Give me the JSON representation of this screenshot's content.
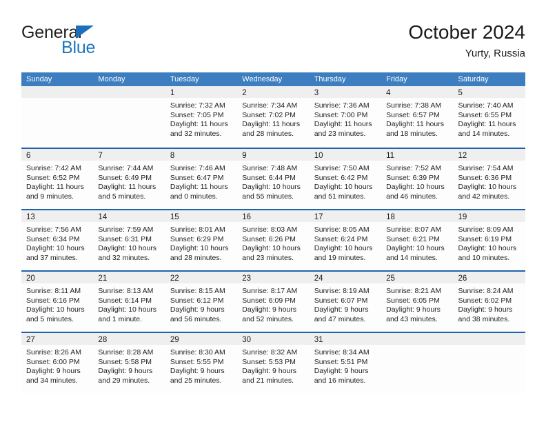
{
  "brand": {
    "name_part1": "General",
    "name_part2": "Blue",
    "triangle_color": "#1c6fba",
    "blue_color": "#1c75bc"
  },
  "header": {
    "title": "October 2024",
    "subtitle": "Yurty, Russia"
  },
  "colors": {
    "header_bar": "#3c7ebf",
    "row_divider": "#1f62ac",
    "day_band": "#efefef",
    "text": "#222222"
  },
  "weekdays": [
    "Sunday",
    "Monday",
    "Tuesday",
    "Wednesday",
    "Thursday",
    "Friday",
    "Saturday"
  ],
  "weeks": [
    [
      {
        "day": "",
        "sunrise": "",
        "sunset": "",
        "daylight1": "",
        "daylight2": ""
      },
      {
        "day": "",
        "sunrise": "",
        "sunset": "",
        "daylight1": "",
        "daylight2": ""
      },
      {
        "day": "1",
        "sunrise": "Sunrise: 7:32 AM",
        "sunset": "Sunset: 7:05 PM",
        "daylight1": "Daylight: 11 hours",
        "daylight2": "and 32 minutes."
      },
      {
        "day": "2",
        "sunrise": "Sunrise: 7:34 AM",
        "sunset": "Sunset: 7:02 PM",
        "daylight1": "Daylight: 11 hours",
        "daylight2": "and 28 minutes."
      },
      {
        "day": "3",
        "sunrise": "Sunrise: 7:36 AM",
        "sunset": "Sunset: 7:00 PM",
        "daylight1": "Daylight: 11 hours",
        "daylight2": "and 23 minutes."
      },
      {
        "day": "4",
        "sunrise": "Sunrise: 7:38 AM",
        "sunset": "Sunset: 6:57 PM",
        "daylight1": "Daylight: 11 hours",
        "daylight2": "and 18 minutes."
      },
      {
        "day": "5",
        "sunrise": "Sunrise: 7:40 AM",
        "sunset": "Sunset: 6:55 PM",
        "daylight1": "Daylight: 11 hours",
        "daylight2": "and 14 minutes."
      }
    ],
    [
      {
        "day": "6",
        "sunrise": "Sunrise: 7:42 AM",
        "sunset": "Sunset: 6:52 PM",
        "daylight1": "Daylight: 11 hours",
        "daylight2": "and 9 minutes."
      },
      {
        "day": "7",
        "sunrise": "Sunrise: 7:44 AM",
        "sunset": "Sunset: 6:49 PM",
        "daylight1": "Daylight: 11 hours",
        "daylight2": "and 5 minutes."
      },
      {
        "day": "8",
        "sunrise": "Sunrise: 7:46 AM",
        "sunset": "Sunset: 6:47 PM",
        "daylight1": "Daylight: 11 hours",
        "daylight2": "and 0 minutes."
      },
      {
        "day": "9",
        "sunrise": "Sunrise: 7:48 AM",
        "sunset": "Sunset: 6:44 PM",
        "daylight1": "Daylight: 10 hours",
        "daylight2": "and 55 minutes."
      },
      {
        "day": "10",
        "sunrise": "Sunrise: 7:50 AM",
        "sunset": "Sunset: 6:42 PM",
        "daylight1": "Daylight: 10 hours",
        "daylight2": "and 51 minutes."
      },
      {
        "day": "11",
        "sunrise": "Sunrise: 7:52 AM",
        "sunset": "Sunset: 6:39 PM",
        "daylight1": "Daylight: 10 hours",
        "daylight2": "and 46 minutes."
      },
      {
        "day": "12",
        "sunrise": "Sunrise: 7:54 AM",
        "sunset": "Sunset: 6:36 PM",
        "daylight1": "Daylight: 10 hours",
        "daylight2": "and 42 minutes."
      }
    ],
    [
      {
        "day": "13",
        "sunrise": "Sunrise: 7:56 AM",
        "sunset": "Sunset: 6:34 PM",
        "daylight1": "Daylight: 10 hours",
        "daylight2": "and 37 minutes."
      },
      {
        "day": "14",
        "sunrise": "Sunrise: 7:59 AM",
        "sunset": "Sunset: 6:31 PM",
        "daylight1": "Daylight: 10 hours",
        "daylight2": "and 32 minutes."
      },
      {
        "day": "15",
        "sunrise": "Sunrise: 8:01 AM",
        "sunset": "Sunset: 6:29 PM",
        "daylight1": "Daylight: 10 hours",
        "daylight2": "and 28 minutes."
      },
      {
        "day": "16",
        "sunrise": "Sunrise: 8:03 AM",
        "sunset": "Sunset: 6:26 PM",
        "daylight1": "Daylight: 10 hours",
        "daylight2": "and 23 minutes."
      },
      {
        "day": "17",
        "sunrise": "Sunrise: 8:05 AM",
        "sunset": "Sunset: 6:24 PM",
        "daylight1": "Daylight: 10 hours",
        "daylight2": "and 19 minutes."
      },
      {
        "day": "18",
        "sunrise": "Sunrise: 8:07 AM",
        "sunset": "Sunset: 6:21 PM",
        "daylight1": "Daylight: 10 hours",
        "daylight2": "and 14 minutes."
      },
      {
        "day": "19",
        "sunrise": "Sunrise: 8:09 AM",
        "sunset": "Sunset: 6:19 PM",
        "daylight1": "Daylight: 10 hours",
        "daylight2": "and 10 minutes."
      }
    ],
    [
      {
        "day": "20",
        "sunrise": "Sunrise: 8:11 AM",
        "sunset": "Sunset: 6:16 PM",
        "daylight1": "Daylight: 10 hours",
        "daylight2": "and 5 minutes."
      },
      {
        "day": "21",
        "sunrise": "Sunrise: 8:13 AM",
        "sunset": "Sunset: 6:14 PM",
        "daylight1": "Daylight: 10 hours",
        "daylight2": "and 1 minute."
      },
      {
        "day": "22",
        "sunrise": "Sunrise: 8:15 AM",
        "sunset": "Sunset: 6:12 PM",
        "daylight1": "Daylight: 9 hours",
        "daylight2": "and 56 minutes."
      },
      {
        "day": "23",
        "sunrise": "Sunrise: 8:17 AM",
        "sunset": "Sunset: 6:09 PM",
        "daylight1": "Daylight: 9 hours",
        "daylight2": "and 52 minutes."
      },
      {
        "day": "24",
        "sunrise": "Sunrise: 8:19 AM",
        "sunset": "Sunset: 6:07 PM",
        "daylight1": "Daylight: 9 hours",
        "daylight2": "and 47 minutes."
      },
      {
        "day": "25",
        "sunrise": "Sunrise: 8:21 AM",
        "sunset": "Sunset: 6:05 PM",
        "daylight1": "Daylight: 9 hours",
        "daylight2": "and 43 minutes."
      },
      {
        "day": "26",
        "sunrise": "Sunrise: 8:24 AM",
        "sunset": "Sunset: 6:02 PM",
        "daylight1": "Daylight: 9 hours",
        "daylight2": "and 38 minutes."
      }
    ],
    [
      {
        "day": "27",
        "sunrise": "Sunrise: 8:26 AM",
        "sunset": "Sunset: 6:00 PM",
        "daylight1": "Daylight: 9 hours",
        "daylight2": "and 34 minutes."
      },
      {
        "day": "28",
        "sunrise": "Sunrise: 8:28 AM",
        "sunset": "Sunset: 5:58 PM",
        "daylight1": "Daylight: 9 hours",
        "daylight2": "and 29 minutes."
      },
      {
        "day": "29",
        "sunrise": "Sunrise: 8:30 AM",
        "sunset": "Sunset: 5:55 PM",
        "daylight1": "Daylight: 9 hours",
        "daylight2": "and 25 minutes."
      },
      {
        "day": "30",
        "sunrise": "Sunrise: 8:32 AM",
        "sunset": "Sunset: 5:53 PM",
        "daylight1": "Daylight: 9 hours",
        "daylight2": "and 21 minutes."
      },
      {
        "day": "31",
        "sunrise": "Sunrise: 8:34 AM",
        "sunset": "Sunset: 5:51 PM",
        "daylight1": "Daylight: 9 hours",
        "daylight2": "and 16 minutes."
      },
      {
        "day": "",
        "sunrise": "",
        "sunset": "",
        "daylight1": "",
        "daylight2": ""
      },
      {
        "day": "",
        "sunrise": "",
        "sunset": "",
        "daylight1": "",
        "daylight2": ""
      }
    ]
  ]
}
